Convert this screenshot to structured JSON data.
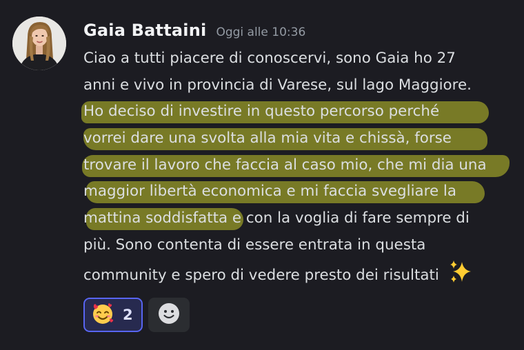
{
  "message": {
    "author": "Gaia Battaini",
    "timestamp": "Oggi alle 10:36",
    "avatar_icon": "user-avatar-photo",
    "lines": [
      "Ciao a tutti piacere di conoscervi, sono Gaia ho 27",
      "anni e vivo in provincia di Varese, sul lago Maggiore.",
      "Ho deciso di investire in questo percorso perché",
      "vorrei dare una svolta alla mia vita e chissà, forse",
      "trovare il lavoro che faccia al caso mio, che mi dia una",
      "maggior libertà economica e mi faccia svegliare la",
      "mattina soddisfatta e con la voglia di fare sempre di",
      "più. Sono contenta di essere entrata in questa",
      "community e spero di vedere presto dei risultati"
    ],
    "trailing_emoji": "sparkles-emoji",
    "highlight_color": "#8c8f27"
  },
  "reactions": [
    {
      "emoji": "smiling-face-with-hearts-emoji",
      "count": "2",
      "active": true
    }
  ],
  "add_reaction_icon": "add-reaction-smiley-icon",
  "colors": {
    "background": "#1c1c22",
    "text": "#dbdee1",
    "timestamp": "#949ba4",
    "reaction_border": "#5865f2"
  }
}
